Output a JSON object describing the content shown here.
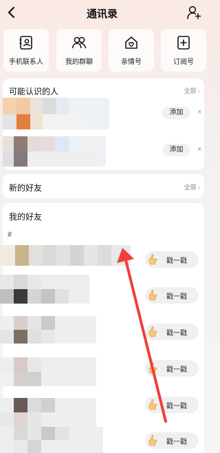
{
  "header": {
    "title": "通讯录",
    "back_icon": "chevron-left-icon",
    "add_icon": "add-friend-icon"
  },
  "quick_actions": [
    {
      "label": "手机联系人",
      "icon": "contacts-book-icon"
    },
    {
      "label": "我的群聊",
      "icon": "group-icon"
    },
    {
      "label": "亲情号",
      "icon": "family-home-icon"
    },
    {
      "label": "订阅号",
      "icon": "subscription-plus-icon"
    }
  ],
  "suggestions": {
    "title": "可能认识的人",
    "more": "全部",
    "items": [
      {
        "action": "添加",
        "dismiss": "×"
      },
      {
        "action": "添加",
        "dismiss": "×"
      }
    ]
  },
  "new_friends": {
    "title": "新的好友",
    "more": "全部"
  },
  "my_friends": {
    "title": "我的好友",
    "group_index": "#",
    "truncated": "...",
    "poke_label": "戳一戳",
    "rows": 6
  },
  "colors": {
    "annotation_arrow": "#ee3f3a",
    "poke_hand": "#f7c97a"
  }
}
